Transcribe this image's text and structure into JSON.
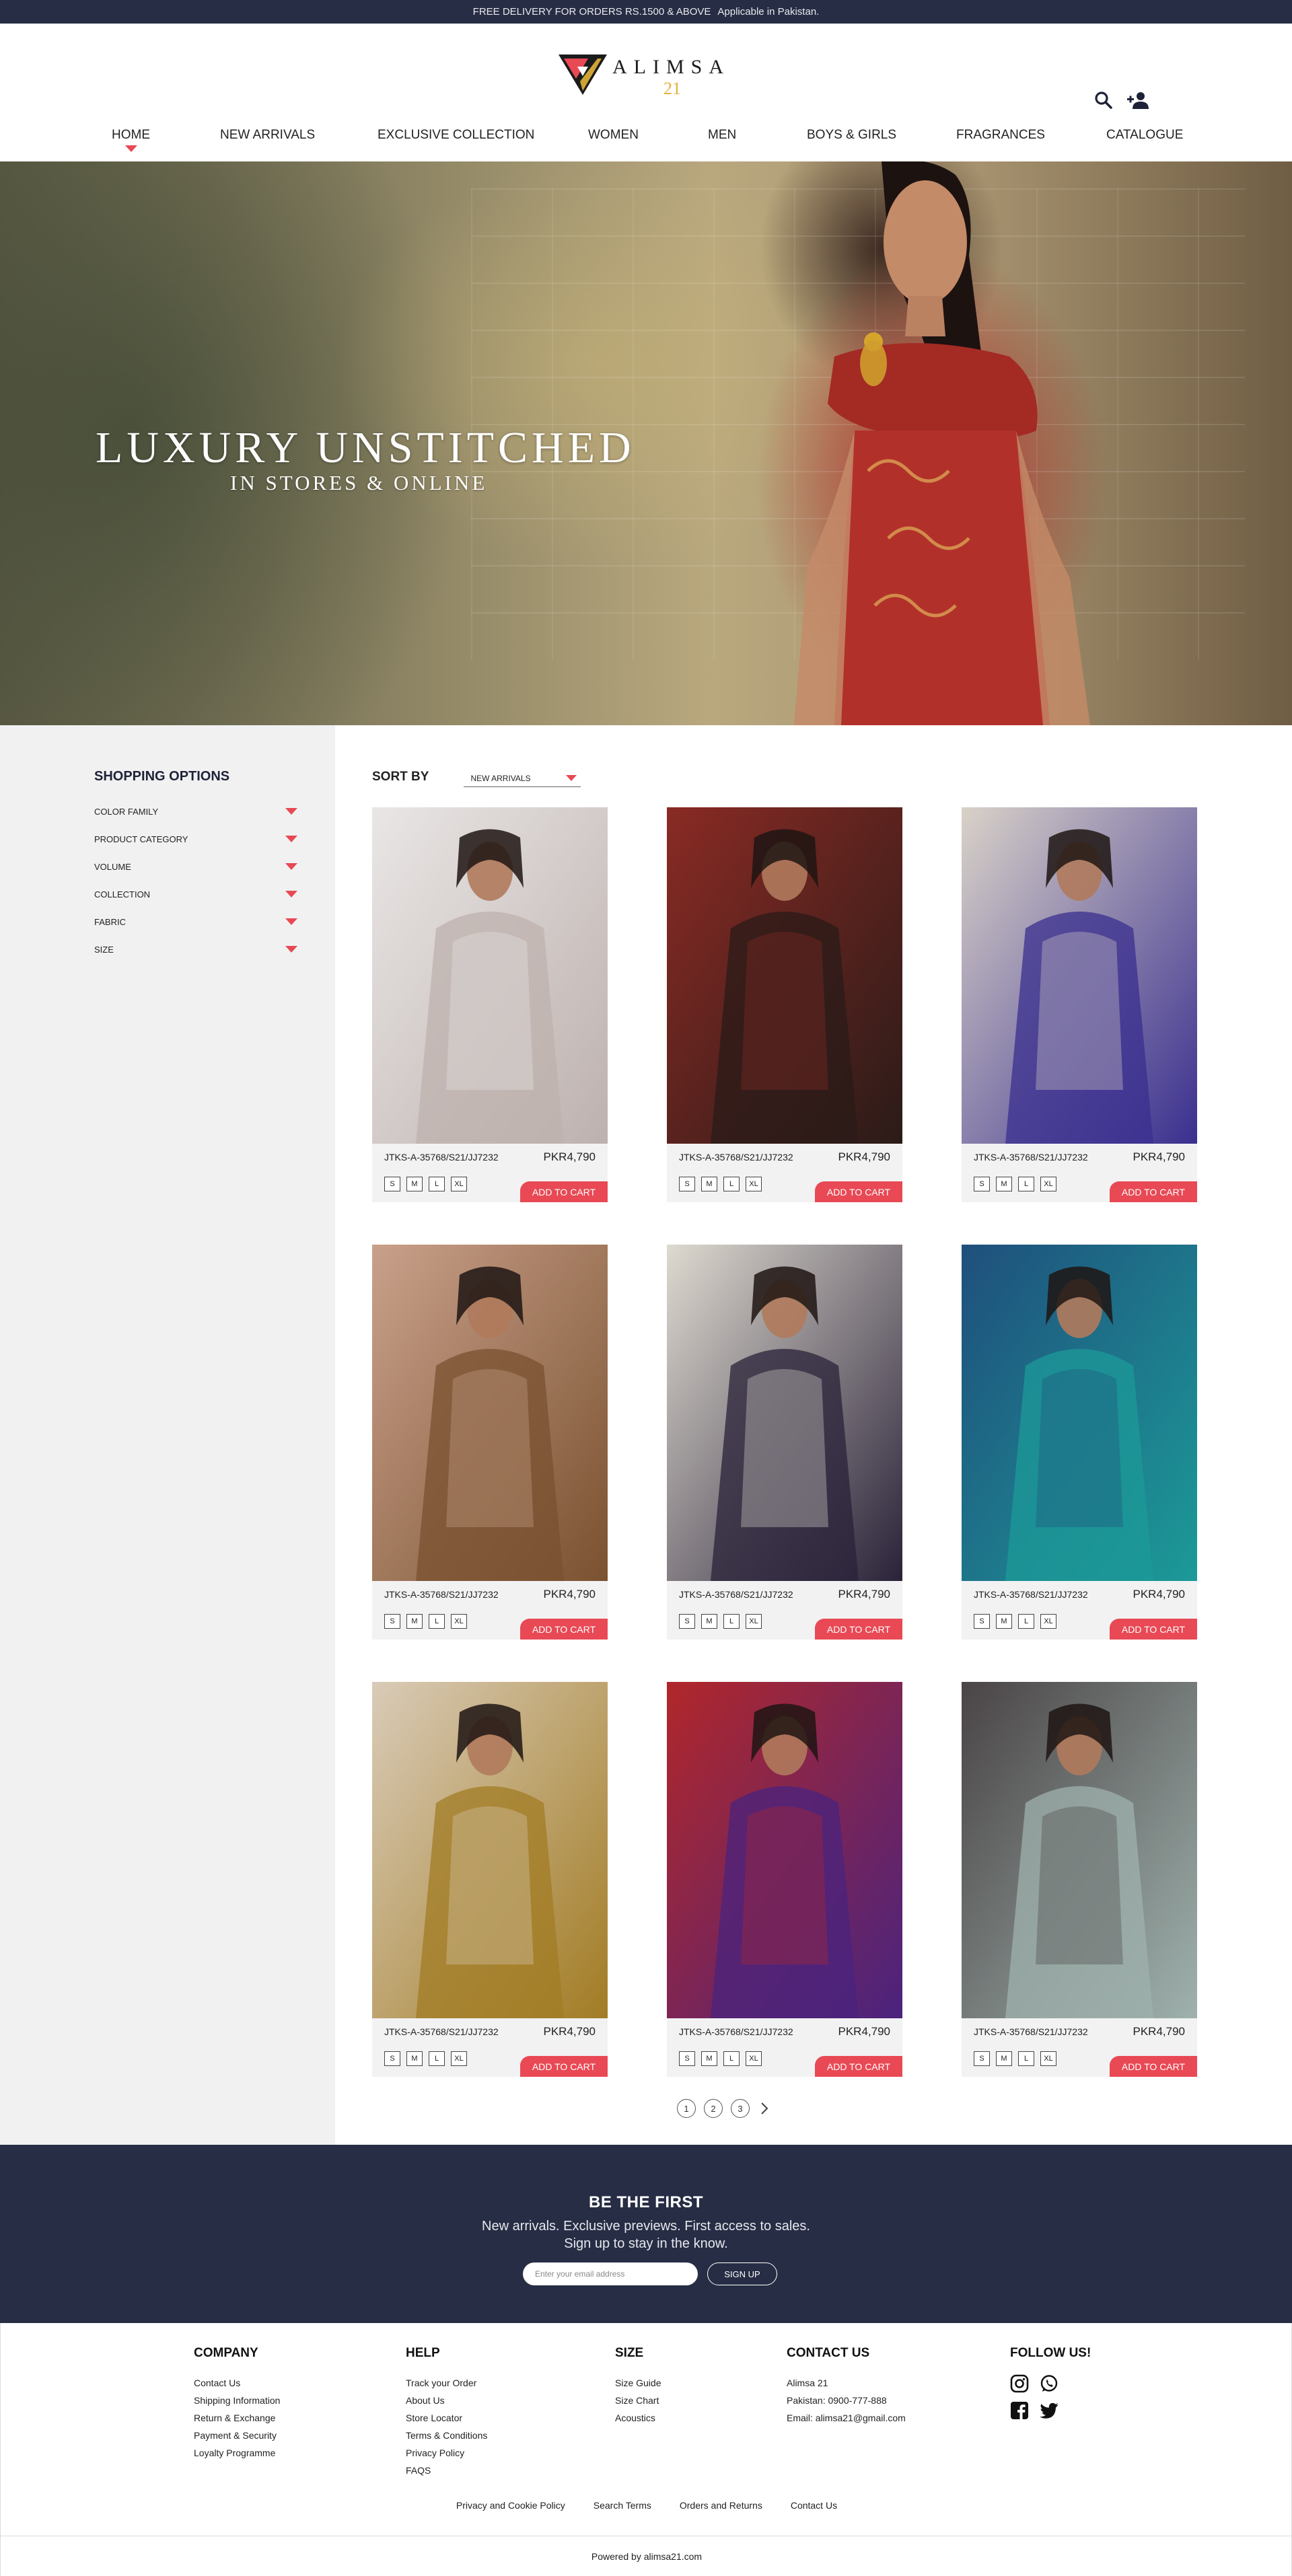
{
  "topbar": {
    "promo": "FREE DELIVERY FOR ORDERS RS.1500 & ABOVE",
    "note": "Applicable in Pakistan."
  },
  "brand": {
    "name": "ALIMSA",
    "number": "21"
  },
  "nav": [
    "HOME",
    "NEW ARRIVALS",
    "EXCLUSIVE COLLECTION",
    "WOMEN",
    "MEN",
    "BOYS & GIRLS",
    "FRAGRANCES",
    "CATALOGUE"
  ],
  "nav_active": "HOME",
  "hero": {
    "title": "LUXURY UNSTITCHED",
    "subtitle": "IN STORES & ONLINE"
  },
  "sidebar": {
    "title": "SHOPPING OPTIONS",
    "filters": [
      "COLOR FAMILY",
      "PRODUCT CATEGORY",
      "VOLUME",
      "COLLECTION",
      "FABRIC",
      "SIZE"
    ]
  },
  "sort": {
    "label": "SORT BY",
    "selected": "NEW ARRIVALS"
  },
  "products": [
    {
      "code": "JTKS-A-35768/S21/JJ7232",
      "price": "PKR4,790",
      "sizes": [
        "S",
        "M",
        "L",
        "XL"
      ],
      "cta": "ADD TO CART",
      "colors": [
        "#e9e6e5",
        "#bdb1ae"
      ]
    },
    {
      "code": "JTKS-A-35768/S21/JJ7232",
      "price": "PKR4,790",
      "sizes": [
        "S",
        "M",
        "L",
        "XL"
      ],
      "cta": "ADD TO CART",
      "colors": [
        "#8a2a24",
        "#2a1b18"
      ]
    },
    {
      "code": "JTKS-A-35768/S21/JJ7232",
      "price": "PKR4,790",
      "sizes": [
        "S",
        "M",
        "L",
        "XL"
      ],
      "cta": "ADD TO CART",
      "colors": [
        "#d9d2c8",
        "#3a2f8f"
      ]
    },
    {
      "code": "JTKS-A-35768/S21/JJ7232",
      "price": "PKR4,790",
      "sizes": [
        "S",
        "M",
        "L",
        "XL"
      ],
      "cta": "ADD TO CART",
      "colors": [
        "#c9a08a",
        "#7a5230"
      ]
    },
    {
      "code": "JTKS-A-35768/S21/JJ7232",
      "price": "PKR4,790",
      "sizes": [
        "S",
        "M",
        "L",
        "XL"
      ],
      "cta": "ADD TO CART",
      "colors": [
        "#dedad0",
        "#2a2238"
      ]
    },
    {
      "code": "JTKS-A-35768/S21/JJ7232",
      "price": "PKR4,790",
      "sizes": [
        "S",
        "M",
        "L",
        "XL"
      ],
      "cta": "ADD TO CART",
      "colors": [
        "#1f4f7c",
        "#1c9a98"
      ]
    },
    {
      "code": "JTKS-A-35768/S21/JJ7232",
      "price": "PKR4,790",
      "sizes": [
        "S",
        "M",
        "L",
        "XL"
      ],
      "cta": "ADD TO CART",
      "colors": [
        "#d9cbb8",
        "#a27c24"
      ]
    },
    {
      "code": "JTKS-A-35768/S21/JJ7232",
      "price": "PKR4,790",
      "sizes": [
        "S",
        "M",
        "L",
        "XL"
      ],
      "cta": "ADD TO CART",
      "colors": [
        "#b1272a",
        "#4a237e"
      ]
    },
    {
      "code": "JTKS-A-35768/S21/JJ7232",
      "price": "PKR4,790",
      "sizes": [
        "S",
        "M",
        "L",
        "XL"
      ],
      "cta": "ADD TO CART",
      "colors": [
        "#4a4446",
        "#9fb2ad"
      ]
    }
  ],
  "pagination": [
    "1",
    "2",
    "3"
  ],
  "newsletter": {
    "title": "BE THE FIRST",
    "line1": "New arrivals. Exclusive previews. First access to sales.",
    "line2": "Sign up to stay in the know.",
    "placeholder": "Enter your email address",
    "button": "SIGN UP"
  },
  "footer": {
    "company": {
      "title": "COMPANY",
      "links": [
        "Contact Us",
        "Shipping Information",
        "Return & Exchange",
        "Payment & Security",
        "Loyalty Programme"
      ]
    },
    "help": {
      "title": "HELP",
      "links": [
        "Track your Order",
        "About Us",
        "Store Locator",
        "Terms & Conditions",
        "Privacy Policy",
        "FAQS"
      ]
    },
    "size": {
      "title": "SIZE",
      "links": [
        "Size Guide",
        "Size Chart",
        "Acoustics"
      ]
    },
    "contact": {
      "title": "CONTACT US",
      "lines": [
        "Alimsa 21",
        "Pakistan: 0900-777-888",
        "Email: alimsa21@gmail.com"
      ]
    },
    "follow": {
      "title": "FOLLOW US!",
      "icons": [
        "instagram-icon",
        "whatsapp-icon",
        "facebook-icon",
        "twitter-icon"
      ]
    },
    "bottom_links": [
      "Privacy and Cookie Policy",
      "Search Terms",
      "Orders and Returns",
      "Contact Us"
    ],
    "powered": "Powered by alimsa21.com"
  },
  "colors": {
    "navy": "#272d44",
    "accent": "#e84955",
    "gold": "#e2b23a",
    "panel": "#f1f1f2"
  }
}
